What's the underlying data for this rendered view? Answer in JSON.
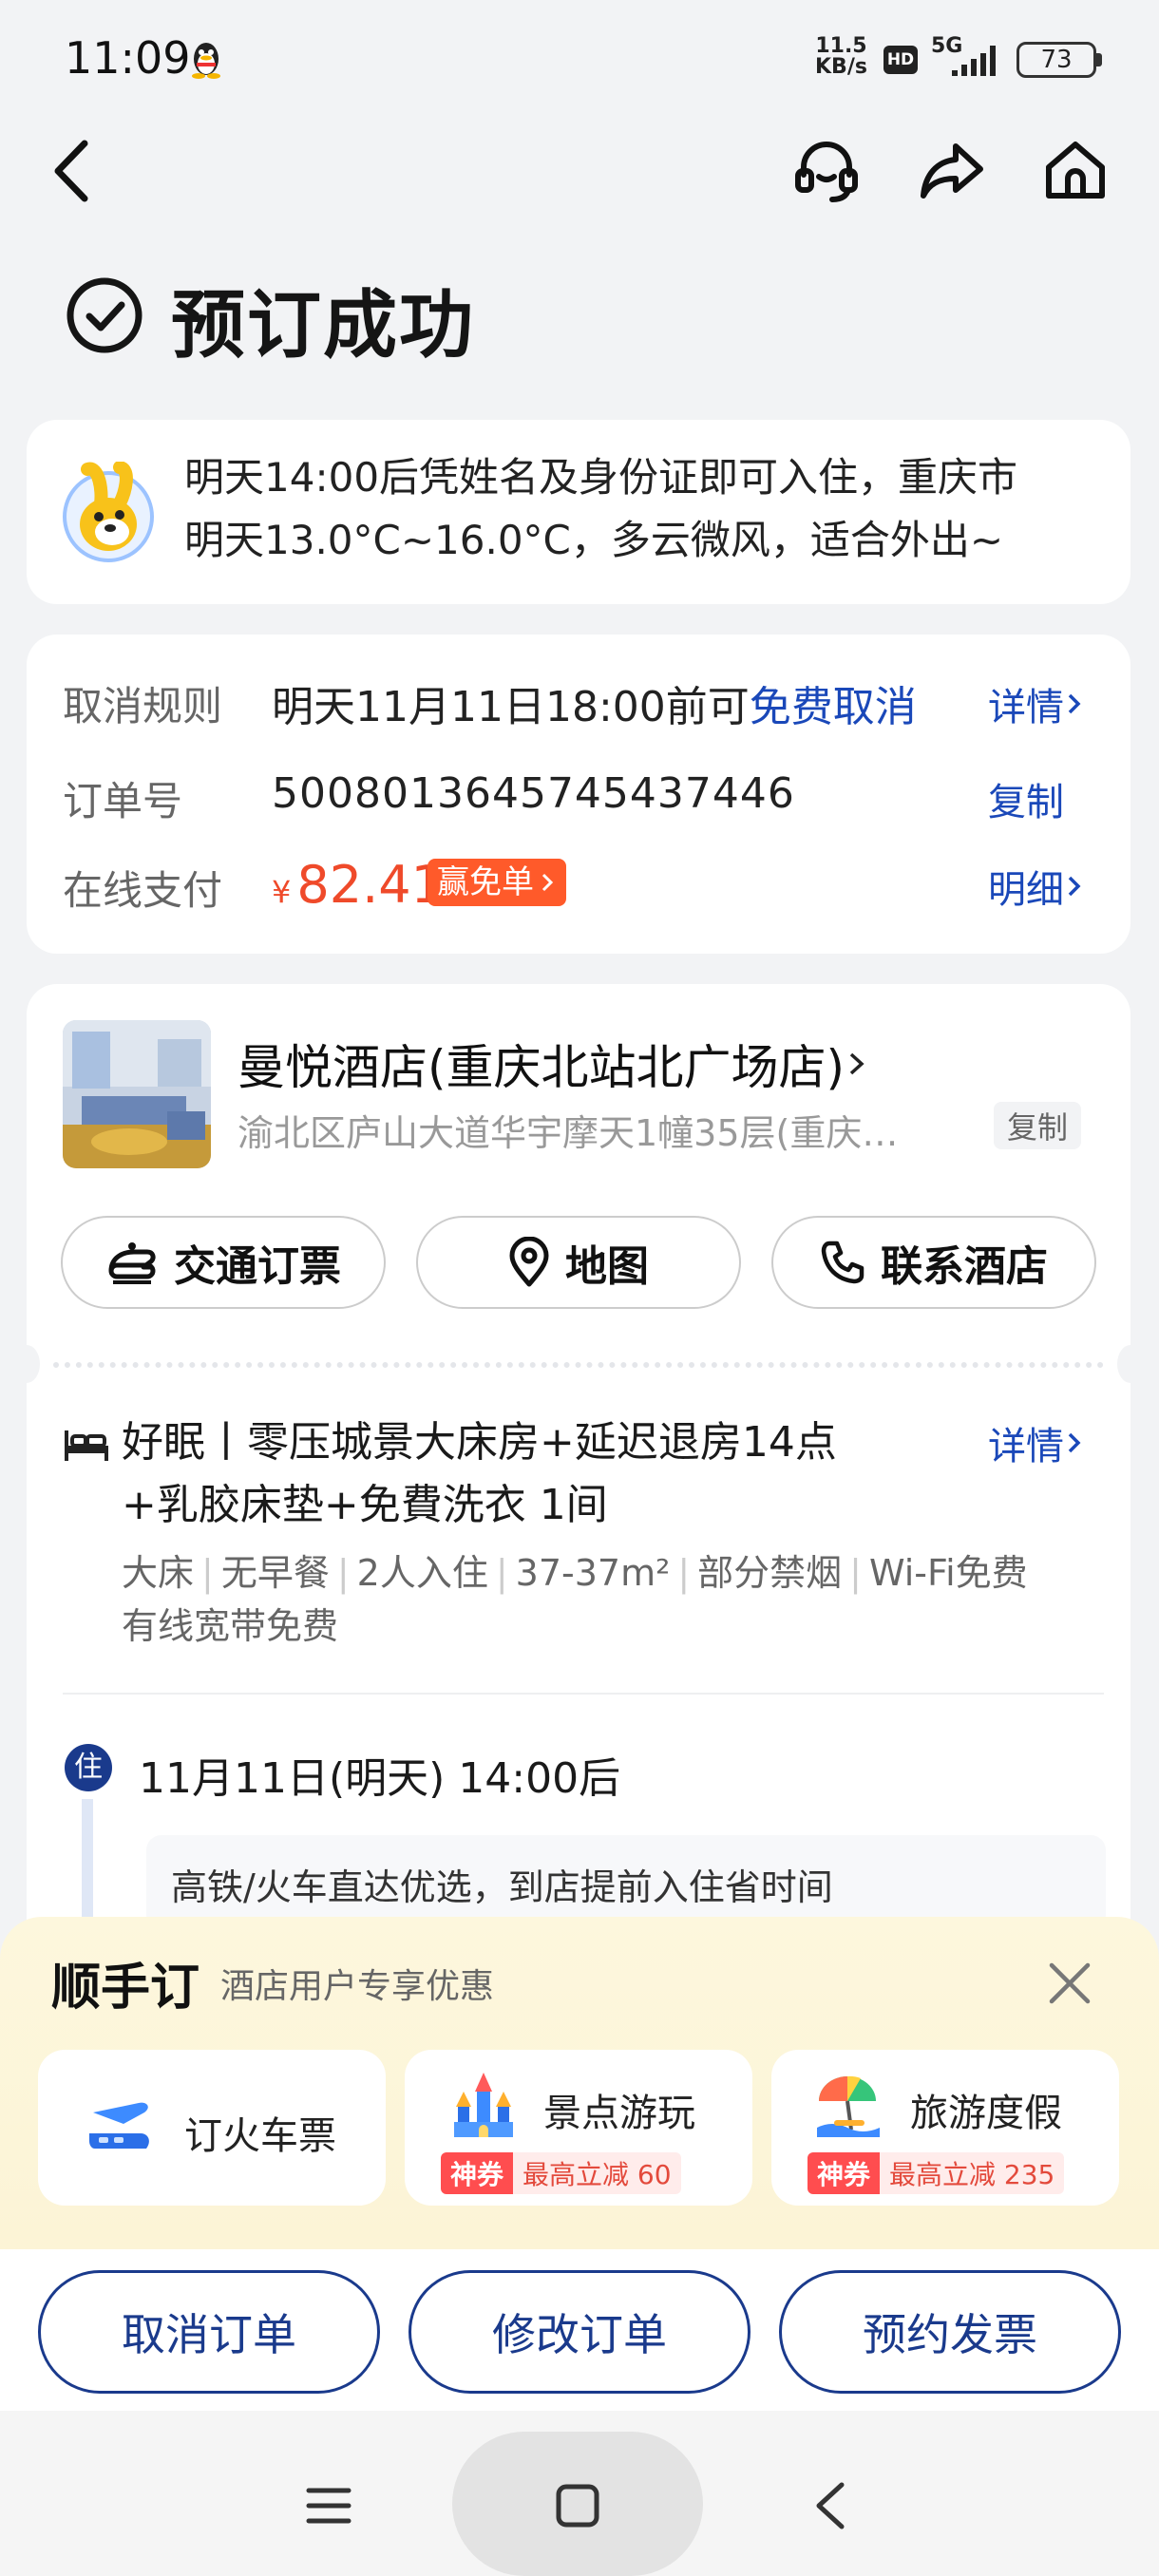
{
  "status_bar": {
    "time": "11:09",
    "net_speed_value": "11.5",
    "net_speed_unit": "KB/s",
    "hd": "HD",
    "network": "5G",
    "battery": "73"
  },
  "nav": {
    "back_icon": "chevron-left-icon",
    "service_icon": "headset-icon",
    "share_icon": "share-icon",
    "home_icon": "home-icon"
  },
  "header": {
    "title": "预订成功"
  },
  "tip": {
    "line1": "明天14:00后凭姓名及身份证即可入住，重庆市",
    "line2": "明天13.0°C~16.0°C，多云微风，适合外出~"
  },
  "order": {
    "cancel_label": "取消规则",
    "cancel_prefix": "明天11月11日18:00前可",
    "cancel_free": "免费取消",
    "cancel_link": "详情",
    "order_no_label": "订单号",
    "order_no": "5008013645745437446",
    "copy_link": "复制",
    "pay_label": "在线支付",
    "currency": "¥",
    "amount": "82.41",
    "win_free_badge": "赢免单",
    "detail_link": "明细"
  },
  "hotel": {
    "name": "曼悦酒店(重庆北站北广场店)",
    "address": "渝北区庐山大道华宇摩天1幢35层(重庆…",
    "copy": "复制",
    "actions": [
      "交通订票",
      "地图",
      "联系酒店"
    ]
  },
  "room": {
    "title_line1": "好眠丨零压城景大床房+延迟退房14点",
    "title_line2": "+乳胶床垫+免費洗衣 1间",
    "detail_link": "详情",
    "tags_line1": [
      "大床",
      "无早餐",
      "2人入住",
      "37-37m²",
      "部分禁烟",
      "Wi-Fi免费"
    ],
    "tags_line2": "有线宽带免费"
  },
  "checkin": {
    "badge": "住",
    "date": "11月11日(明天) 14:00后",
    "note": "高铁/火车直达优选，到店提前入住省时间"
  },
  "promo": {
    "title": "顺手订",
    "subtitle": "酒店用户专享优惠",
    "items": [
      {
        "label": "订火车票",
        "icon": "train-ticket-icon"
      },
      {
        "label": "景点游玩",
        "icon": "castle-icon",
        "tag": "神券",
        "offer": "最高立减 60"
      },
      {
        "label": "旅游度假",
        "icon": "beach-umbrella-icon",
        "tag": "神券",
        "offer": "最高立减 235"
      }
    ]
  },
  "bottom_actions": [
    "取消订单",
    "修改订单",
    "预约发票"
  ]
}
